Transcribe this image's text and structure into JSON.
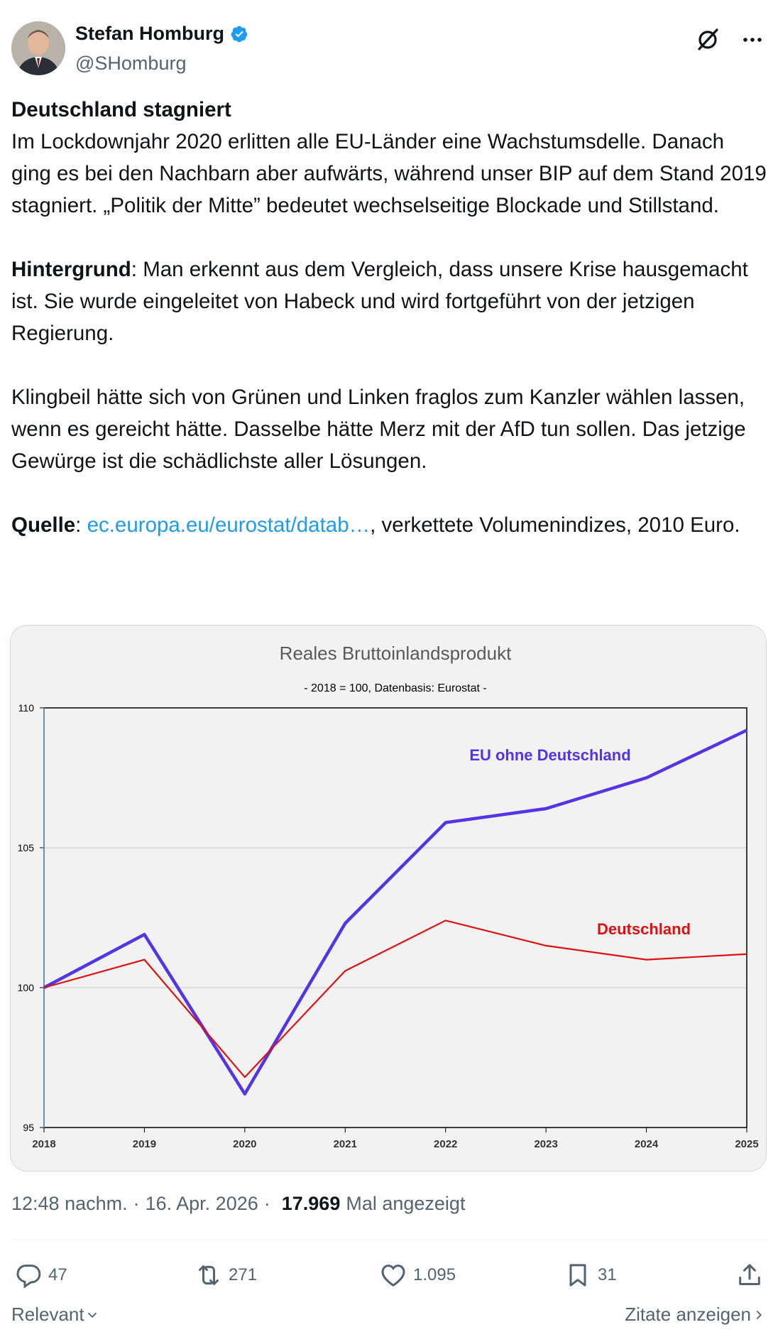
{
  "author": {
    "name": "Stefan Homburg",
    "handle": "@SHomburg"
  },
  "tweet": {
    "headline": "Deutschland stagniert",
    "para1": "Im Lockdownjahr 2020 erlitten alle EU-Länder eine Wachstumsdelle. Danach ging es bei den Nachbarn aber aufwärts, während unser BIP auf dem Stand 2019 stagniert. „Politik der Mitte” bedeutet wechselseitige Blockade und Stillstand.",
    "bg_label": "Hintergrund",
    "bg_text": ": Man erkennt aus dem Vergleich, dass unsere Krise hausgemacht ist. Sie wurde eingeleitet von Habeck und wird fortgeführt von der jetzigen Regierung.",
    "para3": "Klingbeil hätte sich von Grünen und Linken fraglos zum Kanzler wählen lassen, wenn es gereicht hätte. Dasselbe hätte Merz mit der AfD tun sollen. Das jetzige Gewürge ist die schädlichste aller Lösungen.",
    "source_label": "Quelle",
    "source_colon": ": ",
    "source_link": "ec.europa.eu/eurostat/datab…",
    "source_rest": ", verkettete Volumenindizes, 2010 Euro."
  },
  "chart_data": {
    "type": "line",
    "title": "Reales Bruttoinlandsprodukt",
    "subtitle": "- 2018 = 100, Datenbasis: Eurostat -",
    "x": [
      "2018",
      "2019",
      "2020",
      "2021",
      "2022",
      "2023",
      "2024",
      "2025"
    ],
    "ylim": [
      95,
      110
    ],
    "yticks": [
      "95",
      "100",
      "105",
      "110"
    ],
    "grid": true,
    "series": [
      {
        "name": "EU ohne Deutschland",
        "color": "#5533e6",
        "values": [
          100.0,
          101.9,
          96.2,
          102.3,
          105.9,
          106.4,
          107.5,
          109.2
        ]
      },
      {
        "name": "Deutschland",
        "color": "#e01010",
        "values": [
          100.0,
          101.0,
          96.8,
          100.6,
          102.4,
          101.5,
          101.0,
          101.2
        ]
      }
    ]
  },
  "meta": {
    "time": "12:48 nachm.",
    "dot1": "·",
    "date": "16. Apr. 2026",
    "dot2": "·",
    "views": "17.969",
    "views_label": "Mal angezeigt"
  },
  "actions": {
    "replies": "47",
    "reposts": "271",
    "likes": "1.095",
    "bookmarks": "31"
  },
  "footer": {
    "left": "Relevant",
    "right": "Zitate anzeigen"
  },
  "colors": {
    "link": "#1d9bf0",
    "secondary": "#536471",
    "verified": "#1d9bf0"
  }
}
